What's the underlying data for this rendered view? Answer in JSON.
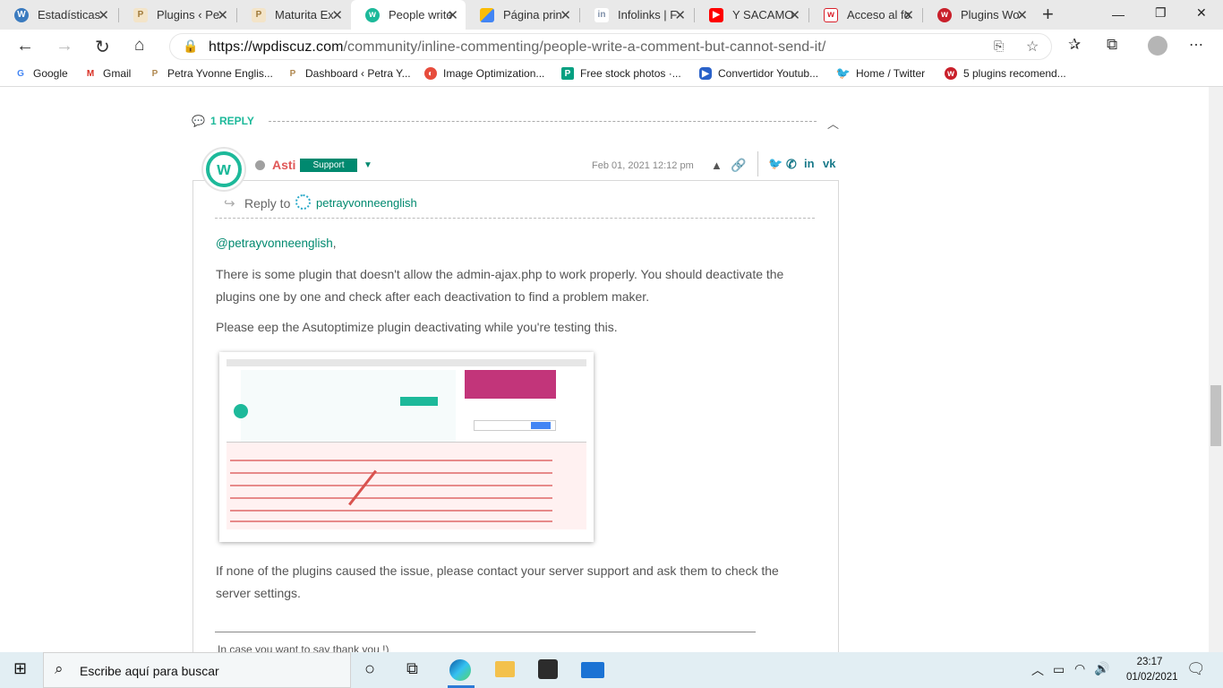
{
  "browser": {
    "tabs": [
      {
        "title": "Estadísticas",
        "icon": "wordpress-icon",
        "active": false
      },
      {
        "title": "Plugins ‹ Pe",
        "icon": "petra-icon",
        "active": false
      },
      {
        "title": "Maturita Ex",
        "icon": "petra-icon",
        "active": false
      },
      {
        "title": "People write",
        "icon": "wpdiscuz-icon",
        "active": true
      },
      {
        "title": "Página prin",
        "icon": "google-ads-icon",
        "active": false
      },
      {
        "title": "Infolinks | F",
        "icon": "infolinks-icon",
        "active": false
      },
      {
        "title": "Y SACAMO",
        "icon": "youtube-icon",
        "active": false
      },
      {
        "title": "Acceso al fo",
        "icon": "w-icon",
        "active": false
      },
      {
        "title": "Plugins Wo",
        "icon": "wpdiscuz-red-icon",
        "active": false
      }
    ],
    "url_domain": "https://wpdiscuz.com",
    "url_path": "/community/inline-commenting/people-write-a-comment-but-cannot-send-it/",
    "bookmarks": [
      {
        "label": "Google",
        "icon": "google-icon"
      },
      {
        "label": "Gmail",
        "icon": "gmail-icon"
      },
      {
        "label": "Petra Yvonne Englis...",
        "icon": "petra-icon"
      },
      {
        "label": "Dashboard ‹ Petra Y...",
        "icon": "petra-icon"
      },
      {
        "label": "Image Optimization...",
        "icon": "image-optimization-icon"
      },
      {
        "label": "Free stock photos ·...",
        "icon": "pexels-icon"
      },
      {
        "label": "Convertidor Youtub...",
        "icon": "converter-icon"
      },
      {
        "label": "Home / Twitter",
        "icon": "twitter-icon"
      },
      {
        "label": "5 plugins recomend...",
        "icon": "wpdiscuz-red-icon"
      }
    ]
  },
  "thread": {
    "reply_count": "1 REPLY"
  },
  "comment": {
    "author": "Asti",
    "badge": "Support",
    "date": "Feb 01, 2021 12:12 pm",
    "reply_to_label": "Reply to",
    "reply_to_name": "petrayvonneenglish",
    "mention": "@petrayvonneenglish",
    "mention_suffix": ",",
    "paragraph1": "There is some plugin that doesn't allow the admin-ajax.php to work properly. You should deactivate the plugins one by one and check after each deactivation to find a problem maker.",
    "paragraph2": "Please eep the Asutoptimize plugin deactivating while you're testing this.",
    "paragraph3": "If none of the plugins caused the issue, please contact your server support and ask them to check the server settings.",
    "thanks": "In case you want to say thank you !)",
    "social": [
      "twitter",
      "whatsapp",
      "linkedin",
      "vk"
    ]
  },
  "taskbar": {
    "search_placeholder": "Escribe aquí para buscar",
    "time": "23:17",
    "date": "01/02/2021"
  },
  "colors": {
    "accent": "#1db99a",
    "badge": "#00896f",
    "author": "#e05858"
  }
}
